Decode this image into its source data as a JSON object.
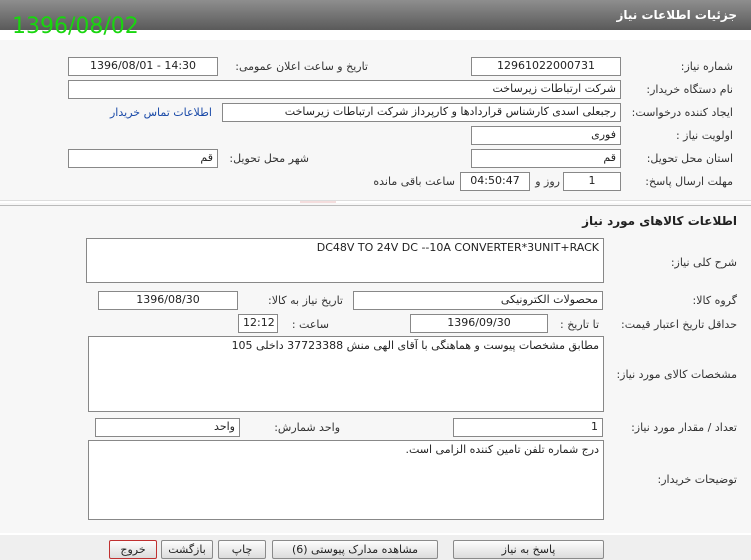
{
  "header": {
    "title": "جزئیات اطلاعات نیاز",
    "stamp_date": "1396/08/02"
  },
  "need_info": {
    "need_number_label": "شماره نیاز:",
    "need_number": "12961022000731",
    "announce_label": "تاریخ و ساعت اعلان عمومی:",
    "announce_value": "1396/08/01 - 14:30",
    "buyer_org_label": "نام دستگاه خریدار:",
    "buyer_org": "شرکت ارتباطات زیرساخت",
    "requester_label": "ایجاد کننده درخواست:",
    "requester": "رجبعلی اسدی کارشناس قراردادها و کارپرداز شرکت ارتباطات زیرساخت",
    "contact_link": "اطلاعات تماس خریدار",
    "priority_label": "اولویت نیاز :",
    "priority": "فوری",
    "province_label": "استان محل تحویل:",
    "province": "قم",
    "city_label": "شهر محل تحویل:",
    "city": "قم",
    "deadline_label": "مهلت ارسال پاسخ:",
    "deadline_days": "1",
    "days_word": "روز و",
    "deadline_time": "04:50:47",
    "remaining_label": "ساعت باقی مانده"
  },
  "goods": {
    "section_title": "اطلاعات کالاهای مورد نیاز",
    "desc_label": "شرح کلی نیاز:",
    "desc": "DC48V  TO 24V DC --10A  CONVERTER*3UNIT+RACK",
    "group_label": "گروه کالا:",
    "group": "محصولات الکترونیکی",
    "need_date_label": "تاریخ نیاز به کالا:",
    "need_date": "1396/08/30",
    "validity_label": "حداقل تاریخ اعتبار قیمت:",
    "until_date_label": "تا تاریخ :",
    "until_date": "1396/09/30",
    "time_label": "ساعت :",
    "time_value": "12:12",
    "specs_label": "مشخصات کالای مورد نیاز:",
    "specs": "مطابق مشخصات پیوست و هماهنگی با آقای الهی منش 37723388  داخلی 105",
    "qty_label": "تعداد / مقدار مورد نیاز:",
    "qty": "1",
    "unit_label": "واحد شمارش:",
    "unit": "واحد",
    "buyer_notes_label": "توضیحات خریدار:",
    "buyer_notes": "درج شماره تلفن تامین کننده الزامی است."
  },
  "buttons": {
    "reply": "پاسخ به نیاز",
    "attachments": "مشاهده مدارک پیوستی (6)",
    "print": "چاپ",
    "back": "بازگشت",
    "exit": "خروج"
  },
  "colors": {
    "stamp": "#19d60f",
    "link": "#1a4aa8",
    "watermark": "#b00000"
  }
}
